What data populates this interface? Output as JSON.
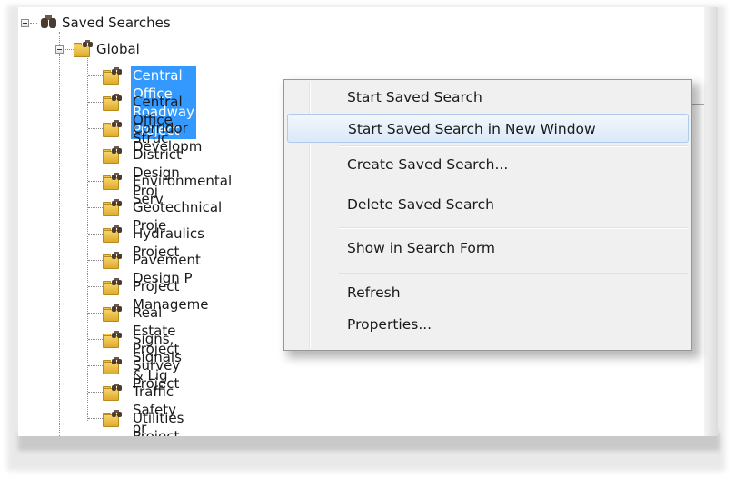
{
  "tree": {
    "root_label": "Saved Searches",
    "global_label": "Global",
    "items": [
      {
        "label": "Central Office Roadway Project",
        "selected": true
      },
      {
        "label": "Central Office Struc"
      },
      {
        "label": "Corridor Developm"
      },
      {
        "label": "District Design Proj"
      },
      {
        "label": "Environmental Serv"
      },
      {
        "label": "Geotechnical Proje"
      },
      {
        "label": "Hydraulics Project"
      },
      {
        "label": "Pavement Design P"
      },
      {
        "label": "Project Manageme"
      },
      {
        "label": "Real Estate Project"
      },
      {
        "label": "Signs, Signals & Lig"
      },
      {
        "label": "Survey Project"
      },
      {
        "label": "Traffic Safety or Mobility"
      },
      {
        "label": "Utilities Project"
      }
    ]
  },
  "context_menu": {
    "items": [
      {
        "label": "Start Saved Search"
      },
      {
        "label": "Start Saved Search in New Window",
        "highlighted": true
      },
      {
        "label": "Create Saved Search..."
      },
      {
        "label": "Delete Saved Search"
      },
      {
        "label": "Show in Search Form"
      },
      {
        "label": "Refresh"
      },
      {
        "label": "Properties..."
      }
    ]
  },
  "icons": {
    "root": "binoculars-icon",
    "folder": "saved-search-folder-icon",
    "expander": "collapse-minus-icon"
  },
  "colors": {
    "selection": "#3399ff",
    "menu_background": "#f0f0f0",
    "menu_hover_border": "#aecbeb"
  }
}
